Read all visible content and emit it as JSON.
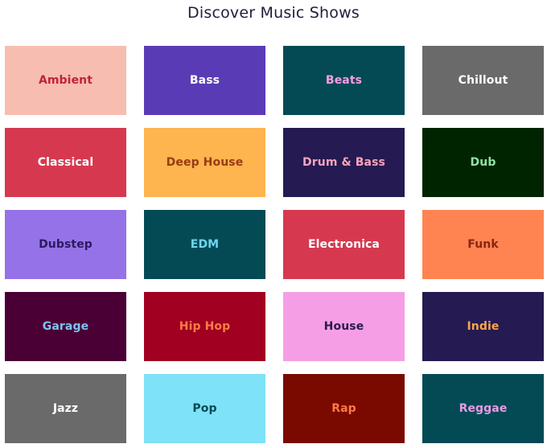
{
  "page": {
    "title": "Discover Music Shows"
  },
  "genres": [
    {
      "label": "Ambient",
      "bg": "#f7bdb0",
      "fg": "#c2213a"
    },
    {
      "label": "Bass",
      "bg": "#5a3bb6",
      "fg": "#ffffff"
    },
    {
      "label": "Beats",
      "bg": "#034a55",
      "fg": "#f59ee6"
    },
    {
      "label": "Chillout",
      "bg": "#6a6a6a",
      "fg": "#ffffff"
    },
    {
      "label": "Classical",
      "bg": "#d6394f",
      "fg": "#ffffff"
    },
    {
      "label": "Deep House",
      "bg": "#feb44f",
      "fg": "#9a3a13"
    },
    {
      "label": "Drum & Bass",
      "bg": "#251a52",
      "fg": "#f6a5bd"
    },
    {
      "label": "Dub",
      "bg": "#012400",
      "fg": "#8fe3a6"
    },
    {
      "label": "Dubstep",
      "bg": "#9672e8",
      "fg": "#2c1a5e"
    },
    {
      "label": "EDM",
      "bg": "#034a55",
      "fg": "#6fd6f0"
    },
    {
      "label": "Electronica",
      "bg": "#d6394f",
      "fg": "#ffffff"
    },
    {
      "label": "Funk",
      "bg": "#ff8452",
      "fg": "#8a2311"
    },
    {
      "label": "Garage",
      "bg": "#4b0035",
      "fg": "#7fc2f2"
    },
    {
      "label": "Hip Hop",
      "bg": "#a10020",
      "fg": "#ff7b47"
    },
    {
      "label": "House",
      "bg": "#f59ee6",
      "fg": "#2b1a4d"
    },
    {
      "label": "Indie",
      "bg": "#251a52",
      "fg": "#fba64c"
    },
    {
      "label": "Jazz",
      "bg": "#6a6a6a",
      "fg": "#ffffff"
    },
    {
      "label": "Pop",
      "bg": "#7ee2f8",
      "fg": "#034a55"
    },
    {
      "label": "Rap",
      "bg": "#7a0a00",
      "fg": "#ff7a45"
    },
    {
      "label": "Reggae",
      "bg": "#034a55",
      "fg": "#e99be3"
    }
  ]
}
